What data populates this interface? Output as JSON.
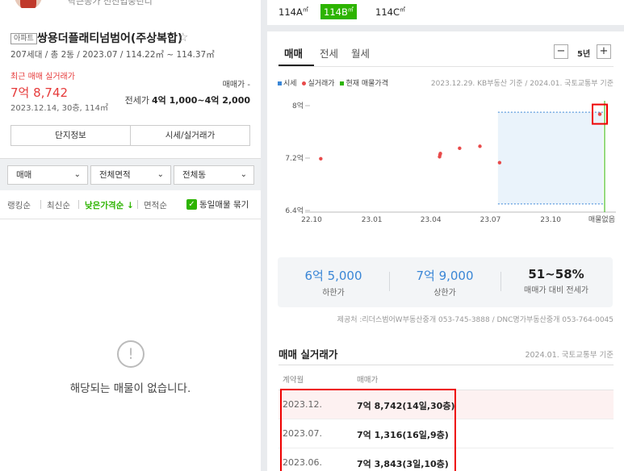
{
  "agent": {
    "name": "락큰공가 전진입중린디"
  },
  "complex": {
    "tag": "아파트",
    "name": "쌍용더플래티넘범어(주상복합)",
    "info": "207세대 / 총 2동 / 2023.07 / 114.22㎡ ~ 114.37㎡"
  },
  "recent": {
    "label": "최근 매매 실거래가",
    "price": "7억 8,742",
    "meta": "2023.12.14, 30층, 114㎡",
    "sale_price_label": "매매가 -",
    "jeonse_label": "전세가",
    "jeonse_value": "4억 1,000~4억 2,000"
  },
  "buttons": {
    "complex_info": "단지정보",
    "price_info": "시세/실거래가"
  },
  "filters": {
    "trade": "매매",
    "area": "전체면적",
    "dong": "전체동"
  },
  "sort": {
    "ranking": "랭킹순",
    "latest": "최신순",
    "low_price": "낮은가격순 ↓",
    "area": "면적순",
    "group_label": "동일매물 묶기"
  },
  "empty": {
    "message": "해당되는 매물이 없습니다."
  },
  "pyeong": {
    "a": "114A",
    "b": "114B",
    "c": "114C",
    "unit": "㎡"
  },
  "trade_tabs": {
    "sale": "매매",
    "jeonse": "전세",
    "monthly": "월세"
  },
  "zoom": {
    "minus": "−",
    "label": "5년",
    "plus": "+"
  },
  "legend": {
    "market": "시세",
    "actual": "실거래가",
    "current": "현재 매물가격",
    "source": "2023.12.29. KB부동산 기준 / 2024.01. 국토교통부 기준",
    "colors": {
      "market": "#3a86d6",
      "actual": "#e84a4a",
      "current": "#2db400"
    }
  },
  "chart_data": {
    "type": "scatter",
    "y_ticks": [
      "8억",
      "7.2억",
      "6.4억"
    ],
    "y_values": [
      8.0,
      7.2,
      6.4
    ],
    "ylim": [
      6.4,
      8.0
    ],
    "x_ticks": [
      "22.10",
      "23.01",
      "23.04",
      "23.07",
      "23.10"
    ],
    "x_end_label": "매물없음",
    "series": [
      {
        "name": "실거래가",
        "points": [
          {
            "x": "2022-10",
            "y": 7.19
          },
          {
            "x": "2023-04",
            "y": 7.22
          },
          {
            "x": "2023-04",
            "y": 7.25
          },
          {
            "x": "2023-04",
            "y": 7.27
          },
          {
            "x": "2023-05",
            "y": 7.35
          },
          {
            "x": "2023-06",
            "y": 7.38
          },
          {
            "x": "2023-07",
            "y": 7.13
          },
          {
            "x": "2023-12",
            "y": 7.87
          }
        ]
      }
    ],
    "highlight_range": [
      "2023-07",
      "2023-12"
    ],
    "highlight_y": [
      6.5,
      7.9
    ],
    "current_line_x": "2023-12"
  },
  "summary": {
    "low": {
      "value": "6억 5,000",
      "label": "하한가"
    },
    "high": {
      "value": "7억 9,000",
      "label": "상한가"
    },
    "ratio": {
      "value": "51~58%",
      "label": "매매가 대비 전세가"
    }
  },
  "provider": "제공처 :리더스범어W부동산중개 053-745-3888 / DNC명가부동산중개 053-764-0045",
  "transactions": {
    "title": "매매 실거래가",
    "source": "2024.01. 국토교통부 기준",
    "headers": {
      "date": "계약월",
      "price": "매매가"
    },
    "rows": [
      {
        "date": "2023.12.",
        "price": "7억 8,742(14일,30층)"
      },
      {
        "date": "2023.07.",
        "price": "7억 1,316(16일,9층)"
      },
      {
        "date": "2023.06.",
        "price": "7억 3,843(3일,10층)"
      }
    ]
  }
}
